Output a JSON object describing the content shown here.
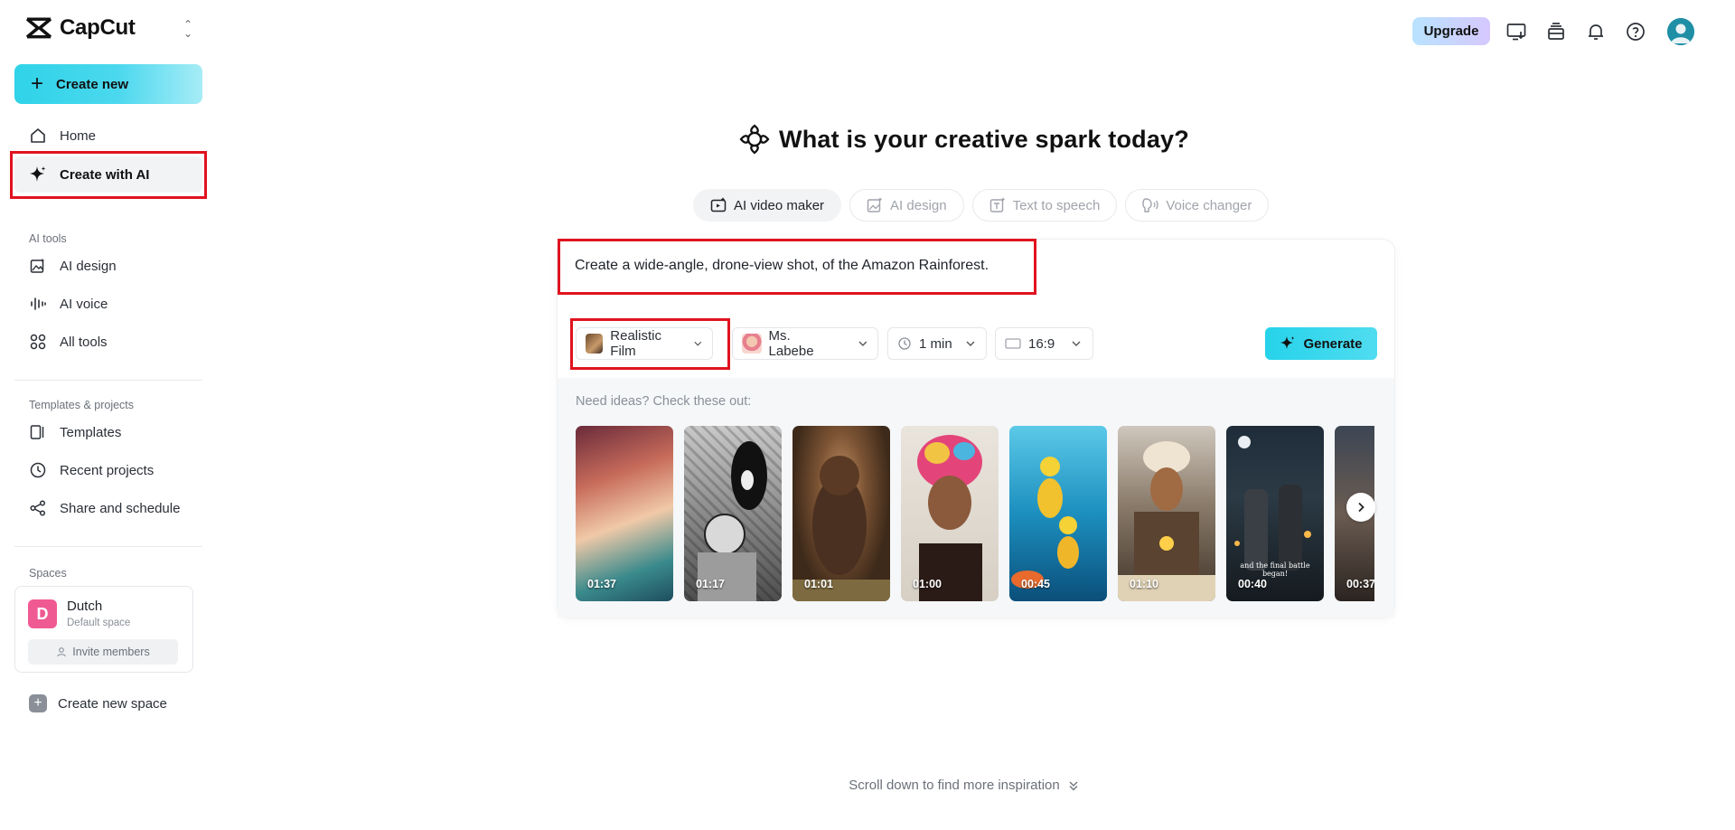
{
  "brand": {
    "name": "CapCut"
  },
  "sidebar": {
    "create_new": "Create new",
    "nav": [
      {
        "label": "Home",
        "icon": "home-icon"
      },
      {
        "label": "Create with AI",
        "icon": "sparkle-icon",
        "active": true
      }
    ],
    "ai_tools_label": "AI tools",
    "ai_tools": [
      {
        "label": "AI design",
        "icon": "image-edit-icon"
      },
      {
        "label": "AI voice",
        "icon": "waveform-icon"
      },
      {
        "label": "All tools",
        "icon": "grid-icon"
      }
    ],
    "templates_label": "Templates & projects",
    "templates": [
      {
        "label": "Templates",
        "icon": "templates-icon"
      },
      {
        "label": "Recent projects",
        "icon": "clock-icon"
      },
      {
        "label": "Share and schedule",
        "icon": "share-icon"
      }
    ],
    "spaces_label": "Spaces",
    "space": {
      "initial": "D",
      "name": "Dutch",
      "subtitle": "Default space",
      "invite": "Invite members"
    },
    "create_space": "Create new space"
  },
  "topbar": {
    "upgrade": "Upgrade",
    "icons": [
      "desktop-download-icon",
      "stack-icon",
      "bell-icon",
      "help-icon",
      "avatar"
    ]
  },
  "main": {
    "title": "What is your creative spark today?",
    "tabs": [
      {
        "label": "AI video maker",
        "icon": "video-plus-icon",
        "active": true
      },
      {
        "label": "AI design",
        "icon": "image-plus-icon"
      },
      {
        "label": "Text to speech",
        "icon": "text-image-icon"
      },
      {
        "label": "Voice changer",
        "icon": "voice-icon"
      }
    ],
    "prompt": "Create a wide-angle, drone-view shot, of the Amazon Rainforest.",
    "options": {
      "style": "Realistic Film",
      "avatar": "Ms. Labebe",
      "duration": "1 min",
      "ratio": "16:9"
    },
    "generate": "Generate",
    "ideas_label": "Need ideas? Check these out:",
    "ideas": [
      {
        "duration": "01:37",
        "caption": ""
      },
      {
        "duration": "01:17",
        "caption": ""
      },
      {
        "duration": "01:01",
        "caption": ""
      },
      {
        "duration": "01:00",
        "caption": ""
      },
      {
        "duration": "00:45",
        "caption": ""
      },
      {
        "duration": "01:10",
        "caption": ""
      },
      {
        "duration": "00:40",
        "caption": "and the final battle began!"
      },
      {
        "duration": "00:37",
        "caption": ""
      }
    ],
    "scroll_hint": "Scroll down to find more inspiration"
  },
  "colors": {
    "highlight": "#e0131f",
    "accent": "#26d3ea",
    "space_avatar": "#f05a93"
  }
}
